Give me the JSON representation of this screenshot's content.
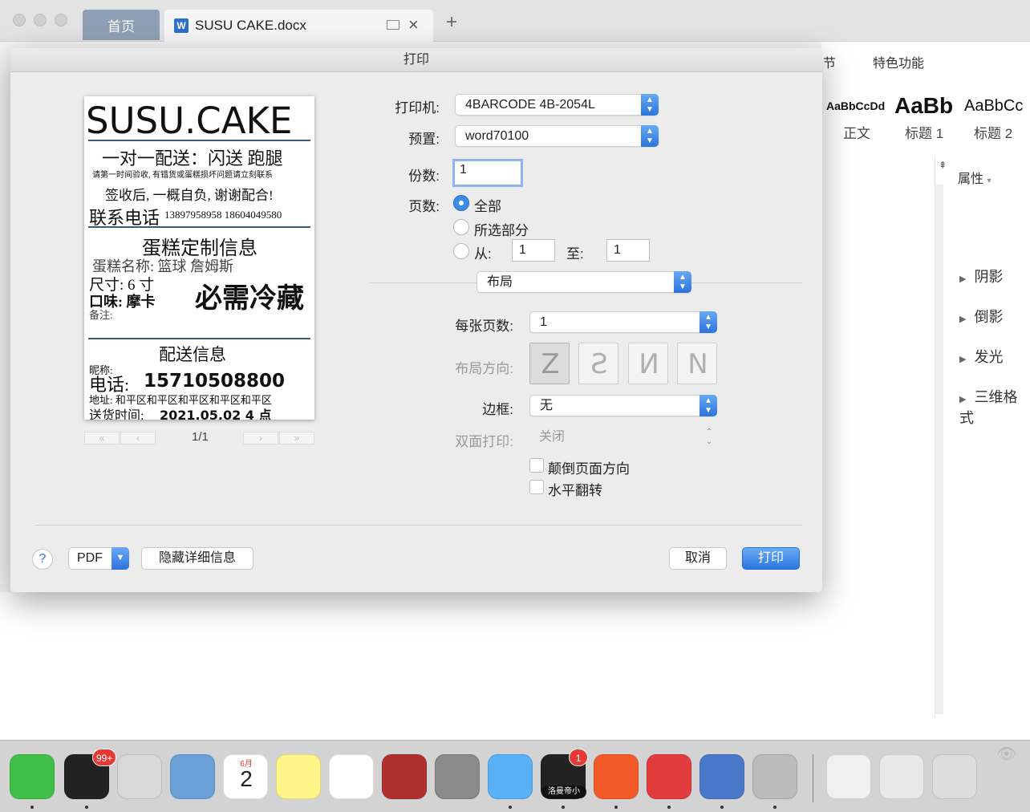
{
  "tabs": {
    "home": "首页",
    "doc_title": "SUSU CAKE.docx",
    "doc_icon": "W",
    "new_tab": "+"
  },
  "ribbon": {
    "tab_partial": "节",
    "tab_features": "特色功能",
    "styles": [
      {
        "sample": "AaBbCcDd",
        "name": "正文"
      },
      {
        "sample": "AaBb",
        "name": "标题 1"
      },
      {
        "sample": "AaBbCc",
        "name": "标题 2"
      }
    ],
    "properties_label": "属性",
    "property_items": [
      "阴影",
      "倒影",
      "发光",
      "三维格式"
    ]
  },
  "dialog": {
    "title": "打印",
    "printer_label": "打印机:",
    "printer_value": "4BARCODE 4B-2054L",
    "preset_label": "预置:",
    "preset_value": "word70100",
    "copies_label": "份数:",
    "copies_value": "1",
    "pages_label": "页数:",
    "pages_all": "全部",
    "pages_selection": "所选部分",
    "pages_from": "从:",
    "pages_from_value": "1",
    "pages_to": "至:",
    "pages_to_value": "1",
    "section_value": "布局",
    "pages_per_sheet_label": "每张页数:",
    "pages_per_sheet_value": "1",
    "layout_direction_label": "布局方向:",
    "layout_direction_options": [
      "Z",
      "S",
      "N",
      "N"
    ],
    "border_label": "边框:",
    "border_value": "无",
    "duplex_label": "双面打印:",
    "duplex_value": "关闭",
    "reverse_orientation": "颠倒页面方向",
    "flip_horizontal": "水平翻转",
    "pager": "1/1",
    "pager_first": "«",
    "pager_prev": "‹",
    "pager_next": "›",
    "pager_last": "»",
    "help": "?",
    "pdf_label": "PDF",
    "hide_details": "隐藏详细信息",
    "cancel": "取消",
    "print": "打印"
  },
  "preview": {
    "title": "SUSU.CAKE",
    "line1": "一对一配送：闪送 跑腿",
    "line2": "请第一时间验收, 有错货或蛋糕损坏问题请立刻联系",
    "line3": "签收后, 一概自负, 谢谢配合!",
    "contact_label": "联系电话",
    "contact_numbers": "13897958958 18604049580",
    "custom_header": "蛋糕定制信息",
    "cake_name": "蛋糕名称: 篮球 詹姆斯",
    "size": "尺寸: 6 寸",
    "flavor": "口味: 摩卡",
    "note": "备注:",
    "refrigerate": "必需冷藏",
    "delivery_header": "配送信息",
    "nickname": "昵称:",
    "phone_label": "电话:",
    "phone_value": "15710508800",
    "address": "地址: 和平区和平区和平区和平区和平区",
    "delivery_time_label": "送货时间:",
    "delivery_time_value": "2021.05.02 4 点"
  },
  "dock": {
    "items": [
      {
        "name": "wechat",
        "color": "#3fbf4a"
      },
      {
        "name": "qq",
        "color": "#222222",
        "badge": "99+"
      },
      {
        "name": "preview-photos",
        "color": "#d8d8d8"
      },
      {
        "name": "mail",
        "color": "#6aa0d8"
      },
      {
        "name": "calendar",
        "color": "#ffffff",
        "month": "6月",
        "day": "2"
      },
      {
        "name": "notes",
        "color": "#fff48a"
      },
      {
        "name": "photos",
        "color": "#ffffff"
      },
      {
        "name": "photo-booth",
        "color": "#b03030"
      },
      {
        "name": "system-preferences",
        "color": "#8a8a8a"
      },
      {
        "name": "messages",
        "color": "#5ab0f5"
      },
      {
        "name": "screen-recorder",
        "color": "#222222",
        "badge": "1",
        "label": "洛曼帝小"
      },
      {
        "name": "infuse",
        "color": "#f35a2a"
      },
      {
        "name": "wps-office",
        "color": "#e23c3c"
      },
      {
        "name": "network-utility",
        "color": "#4a78c8"
      },
      {
        "name": "downloads",
        "color": "#bbbbbb"
      },
      {
        "name": "document-stack",
        "color": "#f0f0f0"
      },
      {
        "name": "screenshot-folder",
        "color": "#e8e8e8"
      },
      {
        "name": "trash",
        "color": "#dddddd"
      }
    ]
  }
}
